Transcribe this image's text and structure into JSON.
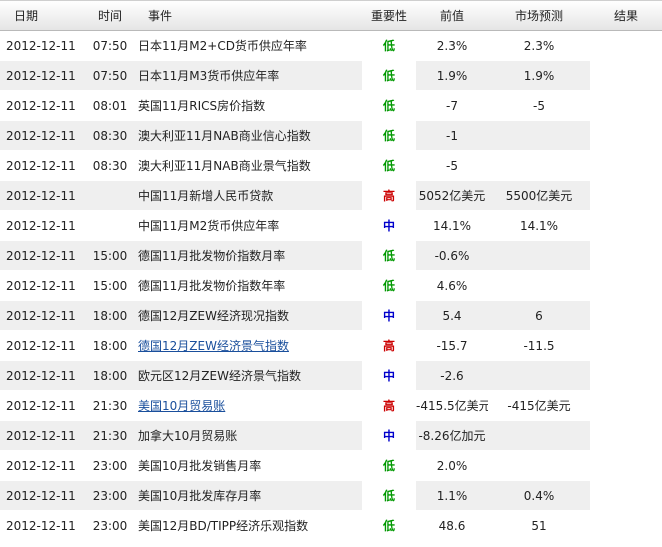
{
  "headers": {
    "date": "日期",
    "time": "时间",
    "event": "事件",
    "importance": "重要性",
    "previous": "前值",
    "forecast": "市场预测",
    "result": "结果"
  },
  "level_colors": {
    "低": "#009900",
    "中": "#0000cc",
    "高": "#cc0000"
  },
  "rows": [
    {
      "date": "2012-12-11",
      "time": "07:50",
      "event": "日本11月M2+CD货币供应年率",
      "importance": "低",
      "previous": "2.3%",
      "forecast": "2.3%",
      "result": "",
      "link": false
    },
    {
      "date": "2012-12-11",
      "time": "07:50",
      "event": "日本11月M3货币供应年率",
      "importance": "低",
      "previous": "1.9%",
      "forecast": "1.9%",
      "result": "",
      "link": false
    },
    {
      "date": "2012-12-11",
      "time": "08:01",
      "event": "英国11月RICS房价指数",
      "importance": "低",
      "previous": "-7",
      "forecast": "-5",
      "result": "",
      "link": false
    },
    {
      "date": "2012-12-11",
      "time": "08:30",
      "event": "澳大利亚11月NAB商业信心指数",
      "importance": "低",
      "previous": "-1",
      "forecast": "",
      "result": "",
      "link": false
    },
    {
      "date": "2012-12-11",
      "time": "08:30",
      "event": "澳大利亚11月NAB商业景气指数",
      "importance": "低",
      "previous": "-5",
      "forecast": "",
      "result": "",
      "link": false
    },
    {
      "date": "2012-12-11",
      "time": "",
      "event": "中国11月新增人民币贷款",
      "importance": "高",
      "previous": "5052亿美元",
      "forecast": "5500亿美元",
      "result": "",
      "link": false
    },
    {
      "date": "2012-12-11",
      "time": "",
      "event": "中国11月M2货币供应年率",
      "importance": "中",
      "previous": "14.1%",
      "forecast": "14.1%",
      "result": "",
      "link": false
    },
    {
      "date": "2012-12-11",
      "time": "15:00",
      "event": "德国11月批发物价指数月率",
      "importance": "低",
      "previous": "-0.6%",
      "forecast": "",
      "result": "",
      "link": false
    },
    {
      "date": "2012-12-11",
      "time": "15:00",
      "event": "德国11月批发物价指数年率",
      "importance": "低",
      "previous": "4.6%",
      "forecast": "",
      "result": "",
      "link": false
    },
    {
      "date": "2012-12-11",
      "time": "18:00",
      "event": "德国12月ZEW经济现况指数",
      "importance": "中",
      "previous": "5.4",
      "forecast": "6",
      "result": "",
      "link": false
    },
    {
      "date": "2012-12-11",
      "time": "18:00",
      "event": "德国12月ZEW经济景气指数",
      "importance": "高",
      "previous": "-15.7",
      "forecast": "-11.5",
      "result": "",
      "link": true
    },
    {
      "date": "2012-12-11",
      "time": "18:00",
      "event": "欧元区12月ZEW经济景气指数",
      "importance": "中",
      "previous": "-2.6",
      "forecast": "",
      "result": "",
      "link": false
    },
    {
      "date": "2012-12-11",
      "time": "21:30",
      "event": "美国10月贸易账",
      "importance": "高",
      "previous": "-415.5亿美元",
      "forecast": "-415亿美元",
      "result": "",
      "link": true
    },
    {
      "date": "2012-12-11",
      "time": "21:30",
      "event": "加拿大10月贸易账",
      "importance": "中",
      "previous": "-8.26亿加元",
      "forecast": "",
      "result": "",
      "link": false
    },
    {
      "date": "2012-12-11",
      "time": "23:00",
      "event": "美国10月批发销售月率",
      "importance": "低",
      "previous": "2.0%",
      "forecast": "",
      "result": "",
      "link": false
    },
    {
      "date": "2012-12-11",
      "time": "23:00",
      "event": "美国10月批发库存月率",
      "importance": "低",
      "previous": "1.1%",
      "forecast": "0.4%",
      "result": "",
      "link": false
    },
    {
      "date": "2012-12-11",
      "time": "23:00",
      "event": "美国12月BD/TIPP经济乐观指数",
      "importance": "低",
      "previous": "48.6",
      "forecast": "51",
      "result": "",
      "link": false
    }
  ]
}
